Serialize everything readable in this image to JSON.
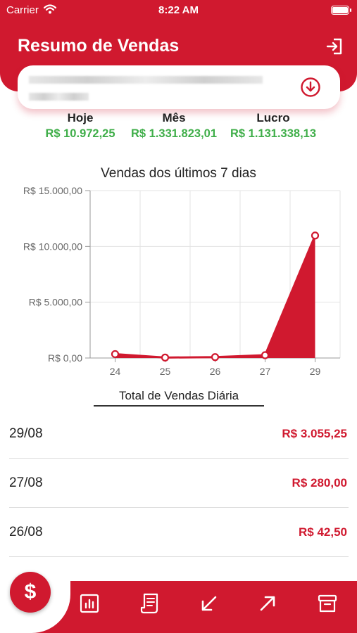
{
  "status_bar": {
    "carrier": "Carrier",
    "time": "8:22 AM"
  },
  "header": {
    "title": "Resumo de Vendas"
  },
  "summary": [
    {
      "label": "Hoje",
      "value": "R$ 10.972,25"
    },
    {
      "label": "Mês",
      "value": "R$ 1.331.823,01"
    },
    {
      "label": "Lucro",
      "value": "R$ 1.131.338,13"
    }
  ],
  "chart_data": {
    "type": "area",
    "title": "Vendas dos últimos 7 dias",
    "categories": [
      "24",
      "25",
      "26",
      "27",
      "29"
    ],
    "values": [
      350,
      40,
      80,
      250,
      10972.25
    ],
    "ylim": [
      0,
      15000
    ],
    "yticks": [
      "R$ 0,00",
      "R$ 5.000,00",
      "R$ 10.000,00",
      "R$ 15.000,00"
    ],
    "grid": true,
    "color": "#d0192f"
  },
  "daily": {
    "title": "Total de Vendas Diária",
    "rows": [
      {
        "date": "29/08",
        "value": "R$ 3.055,25"
      },
      {
        "date": "27/08",
        "value": "R$ 280,00"
      },
      {
        "date": "26/08",
        "value": "R$ 42,50"
      }
    ]
  },
  "colors": {
    "brand": "#d0192f",
    "positive": "#3fae49"
  },
  "tab_bar": {
    "fab_icon": "dollar-icon",
    "fab_symbol": "$",
    "icons": [
      "report-chart-icon",
      "receipt-icon",
      "incoming-arrow-icon",
      "outgoing-arrow-icon",
      "archive-box-icon"
    ]
  }
}
